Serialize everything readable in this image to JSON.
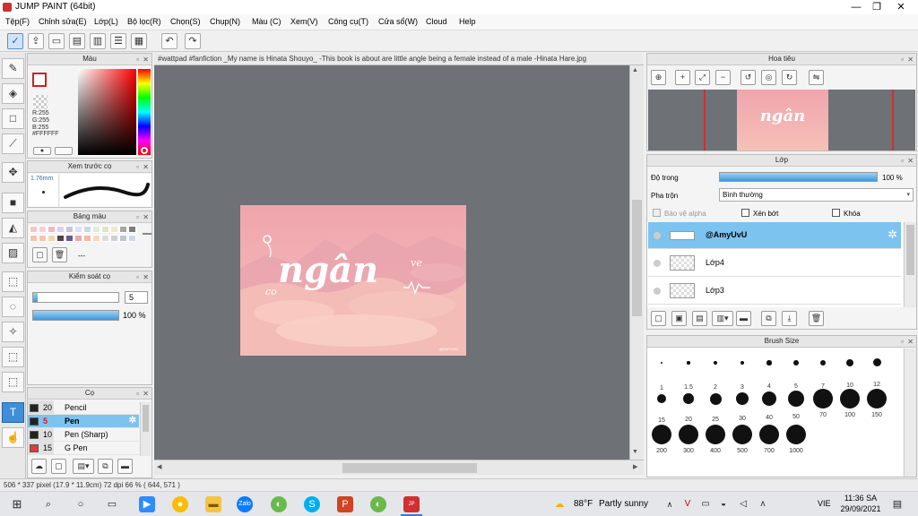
{
  "window": {
    "title": "JUMP PAINT (64bit)",
    "controls": [
      "—",
      "❐",
      "✕"
    ]
  },
  "menu": [
    "Tệp(F)",
    "Chỉnh sửa(E)",
    "Lớp(L)",
    "Bộ lọc(R)",
    "Chọn(S)",
    "Chụp(N)",
    "Màu (C)",
    "Xem(V)",
    "Công cụ(T)",
    "Cửa sổ(W)",
    "Cloud",
    "Help"
  ],
  "color_panel": {
    "title": "Màu",
    "r": "R:255",
    "g": "G:255",
    "b": "B:255",
    "hex": "#FFFFFF"
  },
  "brush_preview": {
    "title": "Xem trước cọ",
    "size": "1.76mm"
  },
  "palette": {
    "title": "Bảng màu",
    "label": "---",
    "swatches": [
      "#f7c4c9",
      "#f5d0d9",
      "#f3b7c0",
      "#d8d1e8",
      "#c9c3e2",
      "#d6e3f3",
      "#c6d8ec",
      "#e4ecd2",
      "#dde6c6",
      "#f2e7c8",
      "#a7a7a7",
      "#7c7c7c",
      "#f7c3b0",
      "#f6c6a4",
      "#f0d5b5",
      "#57423e",
      "#6b5b88",
      "#e7a9a8",
      "#f0b99f",
      "#f5d9c1",
      "#dcdcdc",
      "#cfcfcf",
      "#bcc6d4",
      "#cfd8e6"
    ]
  },
  "brush_control": {
    "title": "Kiểm soát cọ",
    "size_value": "5",
    "opacity_value": "100 %",
    "size_fraction": 0.05,
    "opacity_fraction": 1.0
  },
  "brush_list": {
    "title": "Cọ",
    "items": [
      {
        "size": "20",
        "name": "Pencil",
        "color": "#222222"
      },
      {
        "size": "5",
        "name": "Pen",
        "color": "#222222"
      },
      {
        "size": "10",
        "name": "Pen (Sharp)",
        "color": "#222222"
      },
      {
        "size": "15",
        "name": "G Pen",
        "color": "#e53838"
      }
    ],
    "selected_index": 1
  },
  "document": {
    "tab": "#wattpad #fanfiction _My name is Hinata Shouyo_ -This book is about are little angle being a female instead of a male -Hinata Hare.jpg",
    "artwork_text": "ngân",
    "artwork_small_left": "co",
    "artwork_small_right": "ve",
    "artwork_credit": "@AMYUVU"
  },
  "navigator": {
    "title": "Hoa tiêu"
  },
  "layers": {
    "title": "Lớp",
    "opacity_label": "Độ trong",
    "opacity_value": "100 %",
    "opacity_fraction": 1.0,
    "blend_label": "Pha trộn",
    "blend_value": "Bình thường",
    "protect_alpha": "Bảo vệ alpha",
    "clipping": "Xén bớt",
    "lock": "Khóa",
    "items": [
      {
        "name": "@AmyUvU",
        "selected": true
      },
      {
        "name": "Lớp4",
        "selected": false
      },
      {
        "name": "Lớp3",
        "selected": false
      }
    ]
  },
  "brush_size": {
    "title": "Brush Size",
    "sizes": [
      "1",
      "1.5",
      "2",
      "3",
      "4",
      "5",
      "7",
      "10",
      "12",
      "15",
      "20",
      "25",
      "30",
      "40",
      "50",
      "70",
      "100",
      "150",
      "200",
      "300",
      "400",
      "500",
      "700",
      "1000"
    ]
  },
  "status": {
    "text": "506 * 337 pixel  (17.9 * 11.9cm)  72 dpi  66 %  ( 644, 571 )"
  },
  "taskbar": {
    "weather_temp": "88°F",
    "weather_text": "Partly sunny",
    "lang": "VIE",
    "time": "11:36 SA",
    "date": "29/09/2021"
  },
  "colors": {
    "accent": "#3e8fd8",
    "selected_row": "#7dc3f0",
    "workspace": "#6e7176",
    "artwork_bg": "#f1a7ad"
  }
}
